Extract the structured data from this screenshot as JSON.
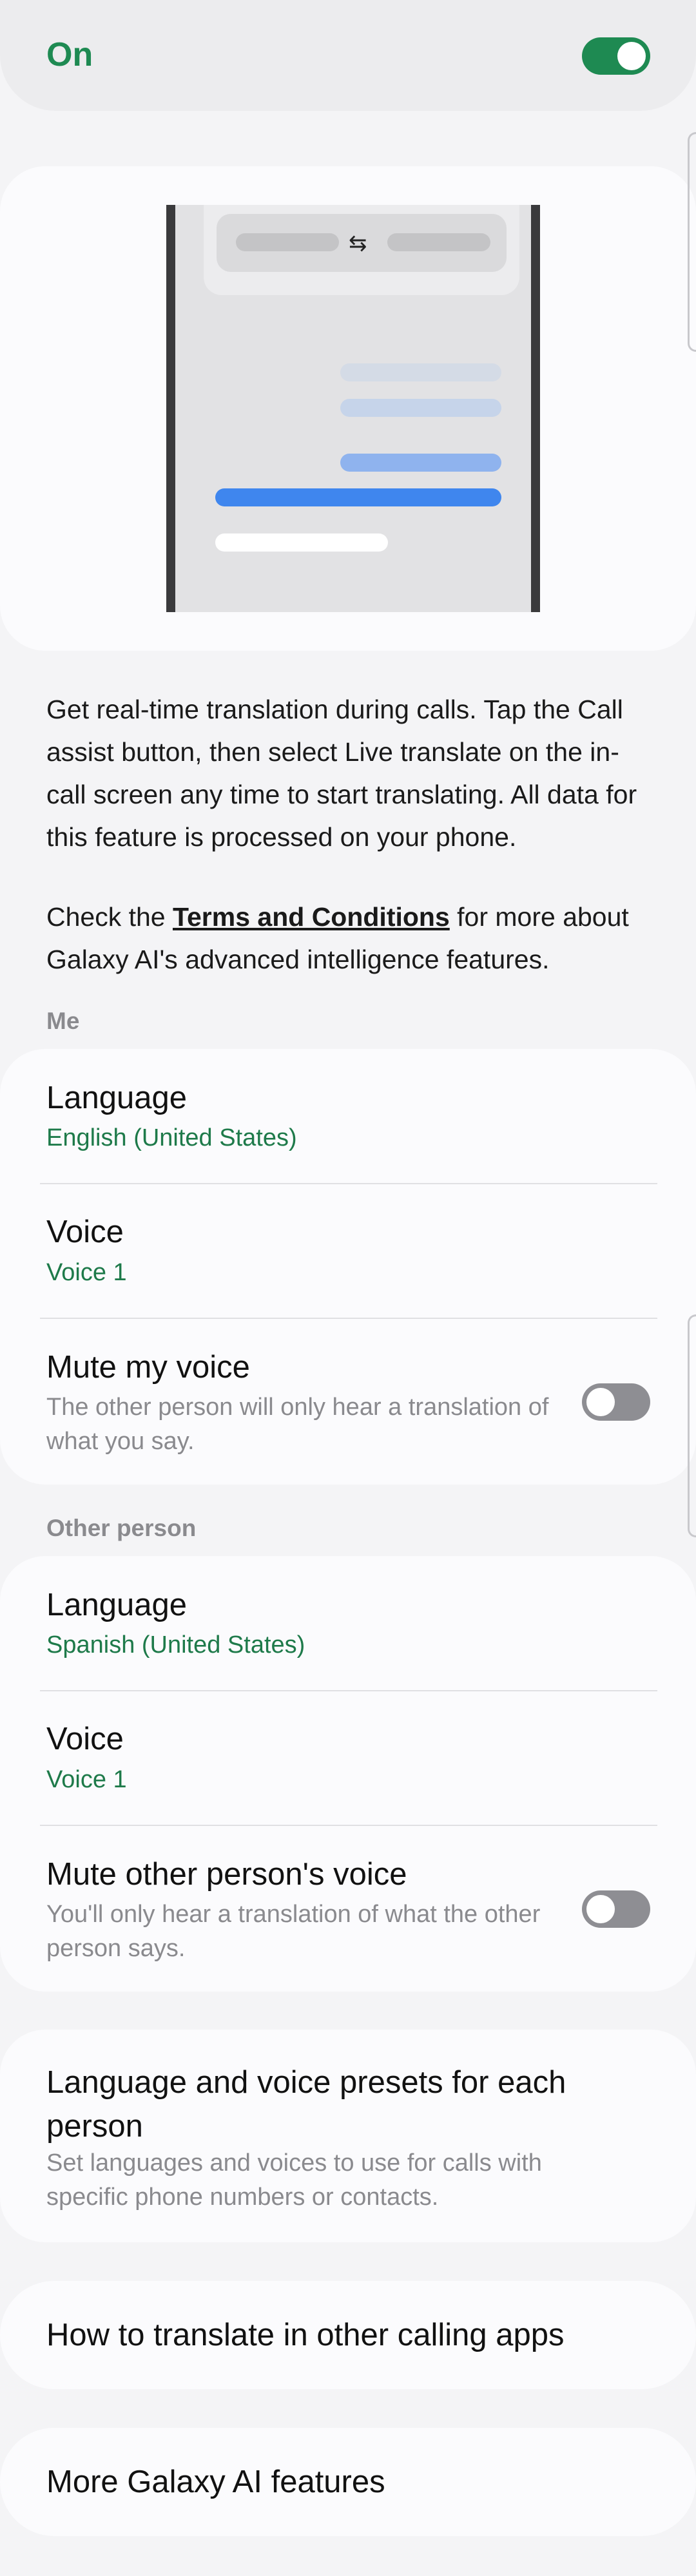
{
  "master_toggle": {
    "label": "On",
    "state": "on"
  },
  "illustration": {
    "swap_glyph": "⇆"
  },
  "description": {
    "paragraph1": "Get real-time translation during calls. Tap the Call assist button, then select Live translate on the in-call screen any time to start translating. All data for this feature is processed on your phone.",
    "terms_prefix": "Check the ",
    "terms_link": "Terms and Conditions",
    "terms_suffix": " for more about Galaxy AI's advanced intelligence features."
  },
  "me": {
    "header": "Me",
    "language_title": "Language",
    "language_value": "English (United States)",
    "voice_title": "Voice",
    "voice_value": "Voice 1",
    "mute_title": "Mute my voice",
    "mute_desc": "The other person will only hear a translation of what you say.",
    "mute_state": "off"
  },
  "other": {
    "header": "Other person",
    "language_title": "Language",
    "language_value": "Spanish (United States)",
    "voice_title": "Voice",
    "voice_value": "Voice 1",
    "mute_title": "Mute other person's voice",
    "mute_desc": "You'll only hear a translation of what the other person says.",
    "mute_state": "off"
  },
  "presets": {
    "title": "Language and voice presets for each person",
    "desc": "Set languages and voices to use for calls with specific phone numbers or contacts."
  },
  "other_apps": {
    "title": "How to translate in other calling apps"
  },
  "more_ai": {
    "title": "More Galaxy AI features"
  },
  "colors": {
    "accent": "#1e8a52",
    "link_green": "#1e7a4a",
    "switch_off": "#8e8e93"
  }
}
